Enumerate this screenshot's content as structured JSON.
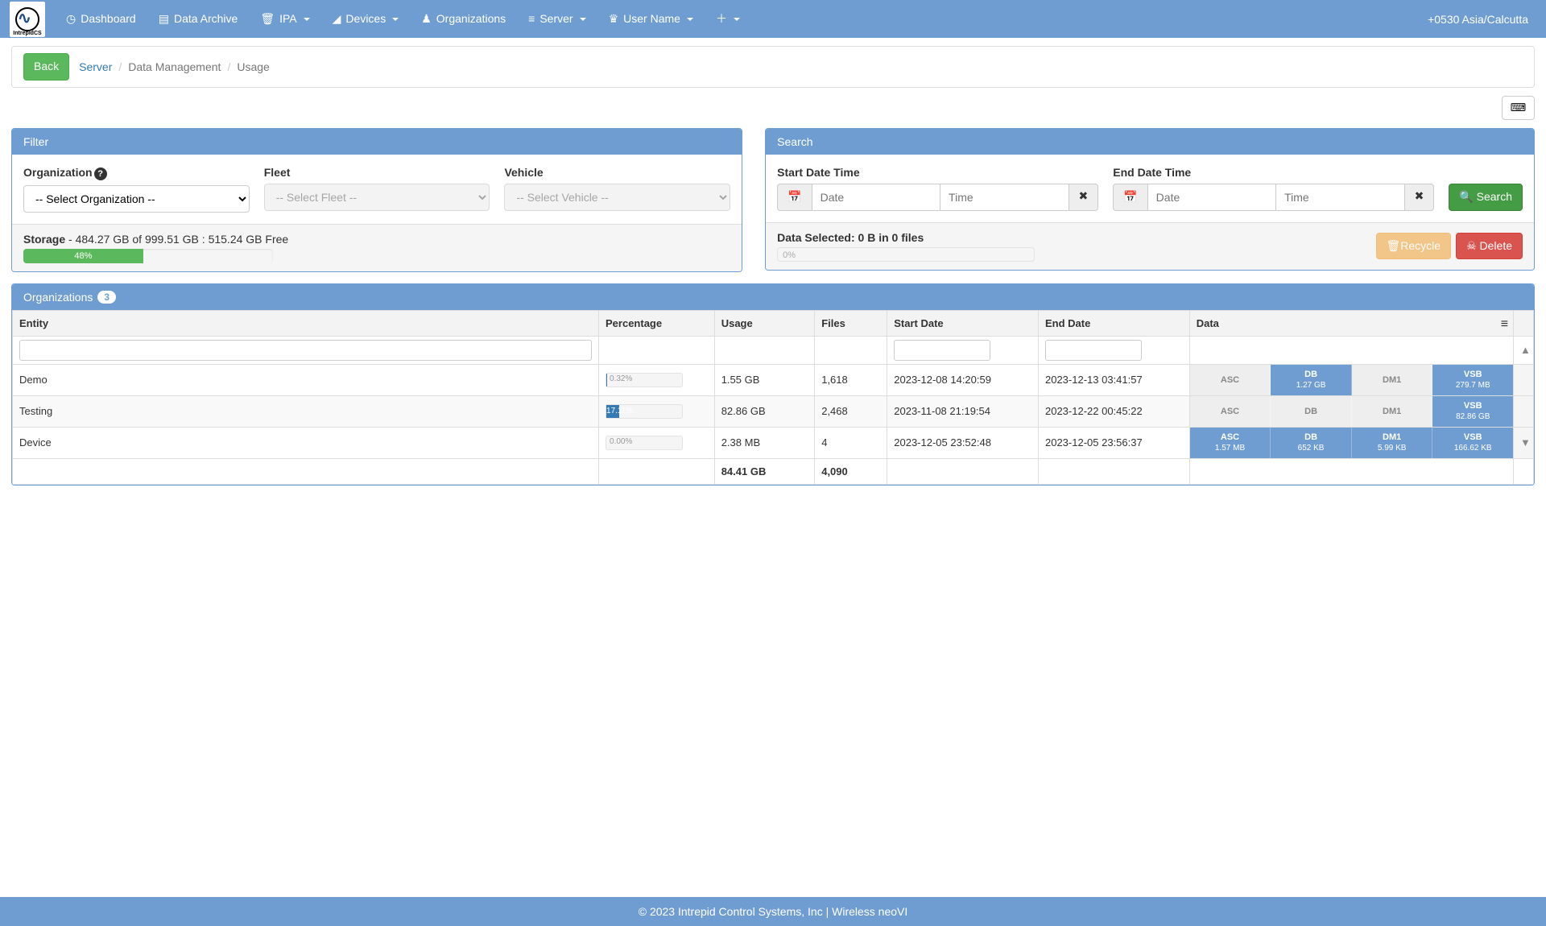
{
  "nav": {
    "logo_label": "IntrepidCS",
    "items": [
      {
        "label": "Dashboard",
        "icon": "dashboard-icon",
        "caret": false
      },
      {
        "label": "Data Archive",
        "icon": "archive-icon",
        "caret": false
      },
      {
        "label": "IPA",
        "icon": "ipa-icon",
        "caret": true
      },
      {
        "label": "Devices",
        "icon": "devices-icon",
        "caret": true
      },
      {
        "label": "Organizations",
        "icon": "org-icon",
        "caret": false
      },
      {
        "label": "Server",
        "icon": "server-icon",
        "caret": true
      },
      {
        "label": "User Name",
        "icon": "user-icon",
        "caret": true
      },
      {
        "label": "",
        "icon": "plus-icon",
        "caret": true
      }
    ],
    "timezone": "+0530 Asia/Calcutta"
  },
  "breadcrumb": {
    "back": "Back",
    "server": "Server",
    "dm": "Data Management",
    "usage": "Usage"
  },
  "filter": {
    "title": "Filter",
    "org_label": "Organization",
    "org_placeholder": "-- Select Organization --",
    "fleet_label": "Fleet",
    "fleet_placeholder": "-- Select Fleet --",
    "vehicle_label": "Vehicle",
    "vehicle_placeholder": "-- Select Vehicle --",
    "storage_label": "Storage",
    "storage_text": " - 484.27 GB of 999.51 GB : 515.24 GB Free",
    "storage_pct": "48%"
  },
  "search": {
    "title": "Search",
    "start_label": "Start Date Time",
    "end_label": "End Date Time",
    "date_ph": "Date",
    "time_ph": "Time",
    "search_btn": "Search",
    "selected_label": "Data Selected: 0 B in 0 files",
    "recycle": "Recycle",
    "delete": "Delete",
    "zero_pct": "0%"
  },
  "orgs": {
    "title": "Organizations",
    "count": "3",
    "headers": {
      "entity": "Entity",
      "pct": "Percentage",
      "usage": "Usage",
      "files": "Files",
      "sd": "Start Date",
      "ed": "End Date",
      "data": "Data"
    },
    "rows": [
      {
        "entity": "Demo",
        "pct_text": "0.32%",
        "pct_fill": 0.32,
        "usage": "1.55 GB",
        "files": "1,618",
        "sd": "2023-12-08 14:20:59",
        "ed": "2023-12-13 03:41:57",
        "chips": [
          {
            "t": "ASC",
            "s": "",
            "on": false
          },
          {
            "t": "DB",
            "s": "1.27 GB",
            "on": true
          },
          {
            "t": "DM1",
            "s": "",
            "on": false
          },
          {
            "t": "VSB",
            "s": "279.7 MB",
            "on": true
          }
        ]
      },
      {
        "entity": "Testing",
        "pct_text": "17.11%",
        "pct_fill": 17.11,
        "usage": "82.86 GB",
        "files": "2,468",
        "sd": "2023-11-08 21:19:54",
        "ed": "2023-12-22 00:45:22",
        "chips": [
          {
            "t": "ASC",
            "s": "",
            "on": false
          },
          {
            "t": "DB",
            "s": "",
            "on": false
          },
          {
            "t": "DM1",
            "s": "",
            "on": false
          },
          {
            "t": "VSB",
            "s": "82.86 GB",
            "on": true
          }
        ]
      },
      {
        "entity": "Device",
        "pct_text": "0.00%",
        "pct_fill": 0,
        "usage": "2.38 MB",
        "files": "4",
        "sd": "2023-12-05 23:52:48",
        "ed": "2023-12-05 23:56:37",
        "chips": [
          {
            "t": "ASC",
            "s": "1.57 MB",
            "on": true
          },
          {
            "t": "DB",
            "s": "652 KB",
            "on": true
          },
          {
            "t": "DM1",
            "s": "5.99 KB",
            "on": true
          },
          {
            "t": "VSB",
            "s": "166.62 KB",
            "on": true
          }
        ]
      }
    ],
    "totals": {
      "usage": "84.41 GB",
      "files": "4,090"
    }
  },
  "footer": {
    "text": "2023 Intrepid Control Systems, Inc | Wireless neoVI"
  },
  "icons": {
    "dashboard": "◷",
    "archive": "▦",
    "ipa": "🗑",
    "devices": "▂",
    "org": "♟",
    "server": "☰",
    "user": "♛",
    "plus": "＋",
    "calendar": "📅",
    "clear": "✖",
    "search": "🔍",
    "recycle": "🗑",
    "delete": "☠",
    "kbd": "⌨",
    "copyright": "©",
    "menu": "≡"
  }
}
